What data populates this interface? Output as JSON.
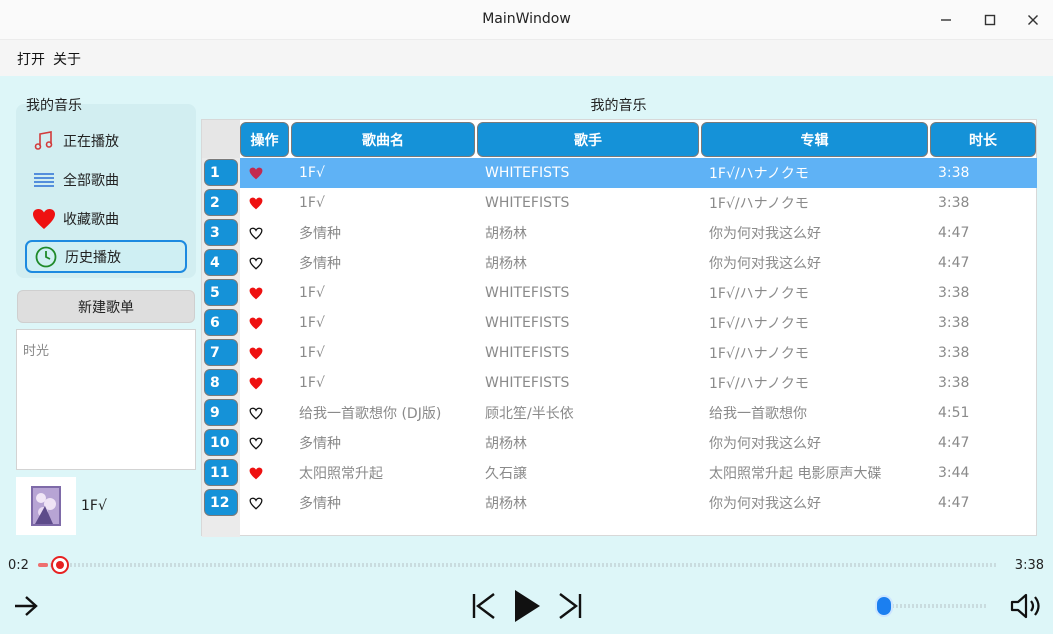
{
  "window": {
    "title": "MainWindow"
  },
  "menu": {
    "open": "打开",
    "about": "关于"
  },
  "sidebar": {
    "group_title": "我的音乐",
    "items": [
      {
        "label": "正在播放",
        "icon": "music-note-icon"
      },
      {
        "label": "全部歌曲",
        "icon": "list-icon"
      },
      {
        "label": "收藏歌曲",
        "icon": "heart-icon"
      },
      {
        "label": "历史播放",
        "icon": "clock-icon",
        "selected": true
      }
    ],
    "new_playlist": "新建歌单",
    "playlists": [
      "时光"
    ],
    "now_playing": "1F√"
  },
  "table": {
    "title": "我的音乐",
    "headers": [
      "操作",
      "歌曲名",
      "歌手",
      "专辑",
      "时长"
    ],
    "rows": [
      {
        "num": "1",
        "fav": true,
        "song": "1F√",
        "artist": "WHITEFISTS",
        "album": "1F√/ハナノクモ",
        "duration": "3:38",
        "selected": true
      },
      {
        "num": "2",
        "fav": true,
        "song": "1F√",
        "artist": "WHITEFISTS",
        "album": "1F√/ハナノクモ",
        "duration": "3:38"
      },
      {
        "num": "3",
        "fav": false,
        "song": "多情种",
        "artist": "胡杨林",
        "album": "你为何对我这么好",
        "duration": "4:47"
      },
      {
        "num": "4",
        "fav": false,
        "song": "多情种",
        "artist": "胡杨林",
        "album": "你为何对我这么好",
        "duration": "4:47"
      },
      {
        "num": "5",
        "fav": true,
        "song": "1F√",
        "artist": "WHITEFISTS",
        "album": "1F√/ハナノクモ",
        "duration": "3:38"
      },
      {
        "num": "6",
        "fav": true,
        "song": "1F√",
        "artist": "WHITEFISTS",
        "album": "1F√/ハナノクモ",
        "duration": "3:38"
      },
      {
        "num": "7",
        "fav": true,
        "song": "1F√",
        "artist": "WHITEFISTS",
        "album": "1F√/ハナノクモ",
        "duration": "3:38"
      },
      {
        "num": "8",
        "fav": true,
        "song": "1F√",
        "artist": "WHITEFISTS",
        "album": "1F√/ハナノクモ",
        "duration": "3:38"
      },
      {
        "num": "9",
        "fav": false,
        "song": "给我一首歌想你 (DJ版)",
        "artist": "顾北笙/半长依",
        "album": "给我一首歌想你",
        "duration": "4:51"
      },
      {
        "num": "10",
        "fav": false,
        "song": "多情种",
        "artist": "胡杨林",
        "album": "你为何对我这么好",
        "duration": "4:47"
      },
      {
        "num": "11",
        "fav": true,
        "song": "太阳照常升起",
        "artist": "久石譲",
        "album": "太阳照常升起 电影原声大碟",
        "duration": "3:44"
      },
      {
        "num": "12",
        "fav": false,
        "song": "多情种",
        "artist": "胡杨林",
        "album": "你为何对我这么好",
        "duration": "4:47"
      }
    ]
  },
  "player": {
    "current_time": "0:2",
    "total_time": "3:38",
    "progress": 0.01,
    "volume": 0.02
  },
  "colors": {
    "accent": "#1592d8",
    "selected_row": "#5fb2f5",
    "heart": "#ee1111",
    "progress": "#e62222",
    "volume": "#1b7ff0"
  }
}
